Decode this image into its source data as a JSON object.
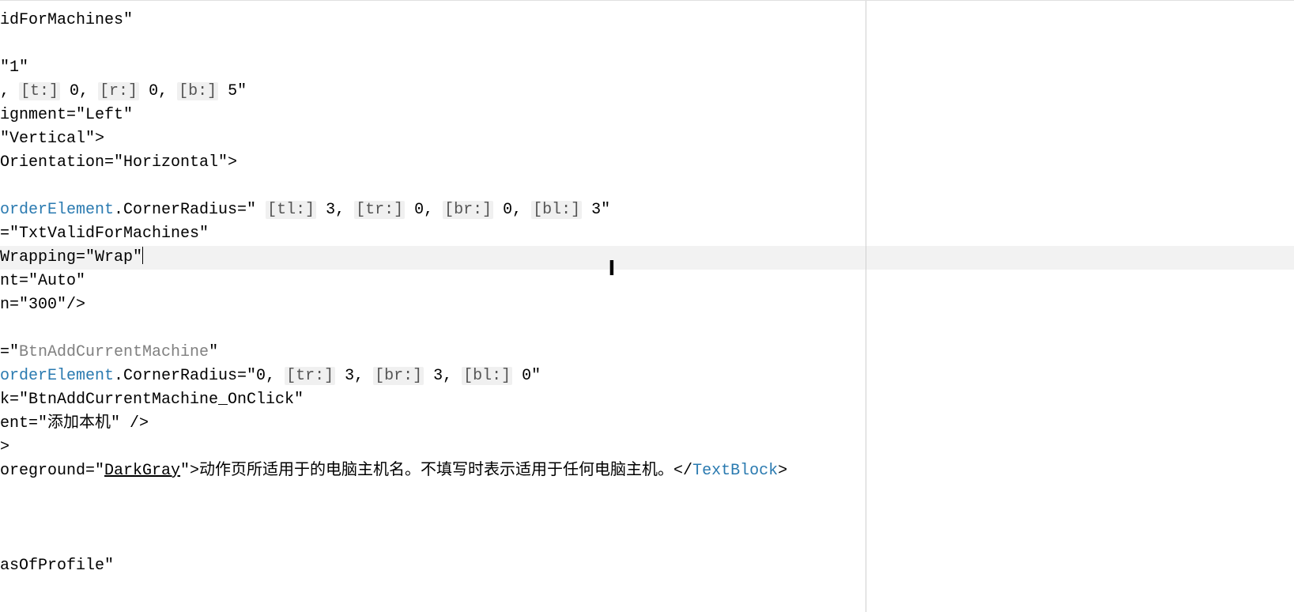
{
  "lines": {
    "l1": "idForMachines\"",
    "l2": "",
    "l3": "\"1\"",
    "l4a": ", ",
    "l4h1": "[t:]",
    "l4b": " 0, ",
    "l4h2": "[r:]",
    "l4c": " 0, ",
    "l4h3": "[b:]",
    "l4d": " 5\"",
    "l5": "ignment=\"Left\"",
    "l6": "\"Vertical\">",
    "l7": "Orientation=\"Horizontal\">",
    "l8": "",
    "l9a": "orderElement",
    "l9b": ".CornerRadius=\" ",
    "l9h1": "[tl:]",
    "l9c": " 3, ",
    "l9h2": "[tr:]",
    "l9d": " 0, ",
    "l9h3": "[br:]",
    "l9e": " 0, ",
    "l9h4": "[bl:]",
    "l9f": " 3\"",
    "l10": "=\"TxtValidForMachines\"",
    "l11a": "Wrapping=",
    "l11b": "\"Wrap\"",
    "l12": "nt=\"Auto\"",
    "l13": "n=\"300\"/>",
    "l14": "",
    "l15a": "=\"",
    "l15b": "BtnAddCurrentMachine",
    "l15c": "\"",
    "l16a": "orderElement",
    "l16b": ".CornerRadius=\"0, ",
    "l16h1": "[tr:]",
    "l16c": " 3, ",
    "l16h2": "[br:]",
    "l16d": " 3, ",
    "l16h3": "[bl:]",
    "l16e": " 0\"",
    "l17": "k=\"BtnAddCurrentMachine_OnClick\"",
    "l18": "ent=\"添加本机\" />",
    "l19": ">",
    "l20a": "oreground=\"",
    "l20b": "DarkGray",
    "l20c": "\">动作页所适用于的电脑主机名。不填写时表示适用于任何电脑主机。</",
    "l20d": "TextBlock",
    "l20e": ">",
    "l21": "",
    "l22": "",
    "l23": "",
    "l24": "asOfProfile\""
  },
  "cursor_glyph": "I"
}
